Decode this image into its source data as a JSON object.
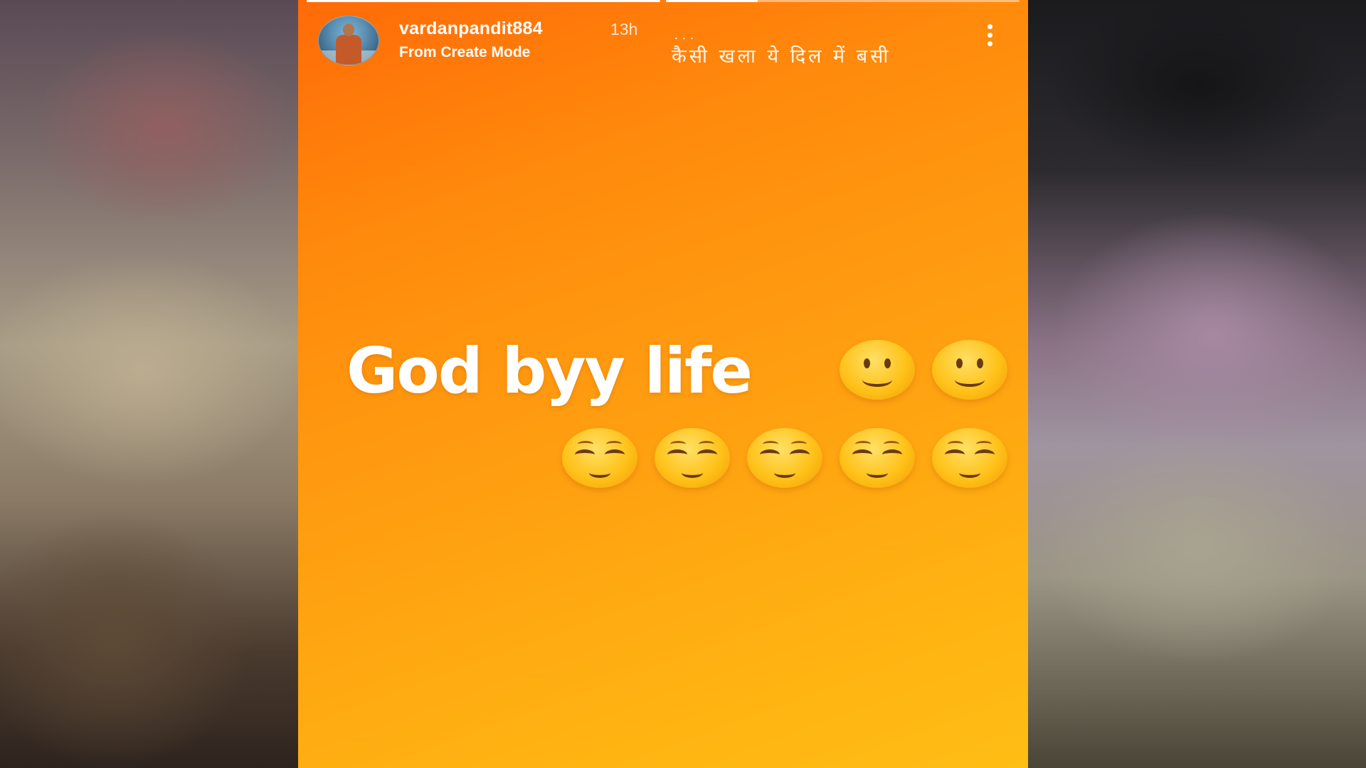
{
  "story": {
    "username": "vardanpandit884",
    "time_ago": "13h",
    "subtitle": "From Create Mode",
    "music_dots": "...",
    "music_title": "कैसी खला ये दिल में बसी",
    "caption": "God byy life",
    "progress": [
      1.0,
      0.26
    ],
    "emoji_row1": [
      "slightly-smiling-face",
      "slightly-smiling-face"
    ],
    "emoji_row2": [
      "relieved-face",
      "relieved-face",
      "relieved-face",
      "relieved-face",
      "relieved-face"
    ],
    "colors": {
      "gradient_top": "#ff6a08",
      "gradient_bottom": "#ffbe14",
      "text": "#ffffff"
    }
  }
}
